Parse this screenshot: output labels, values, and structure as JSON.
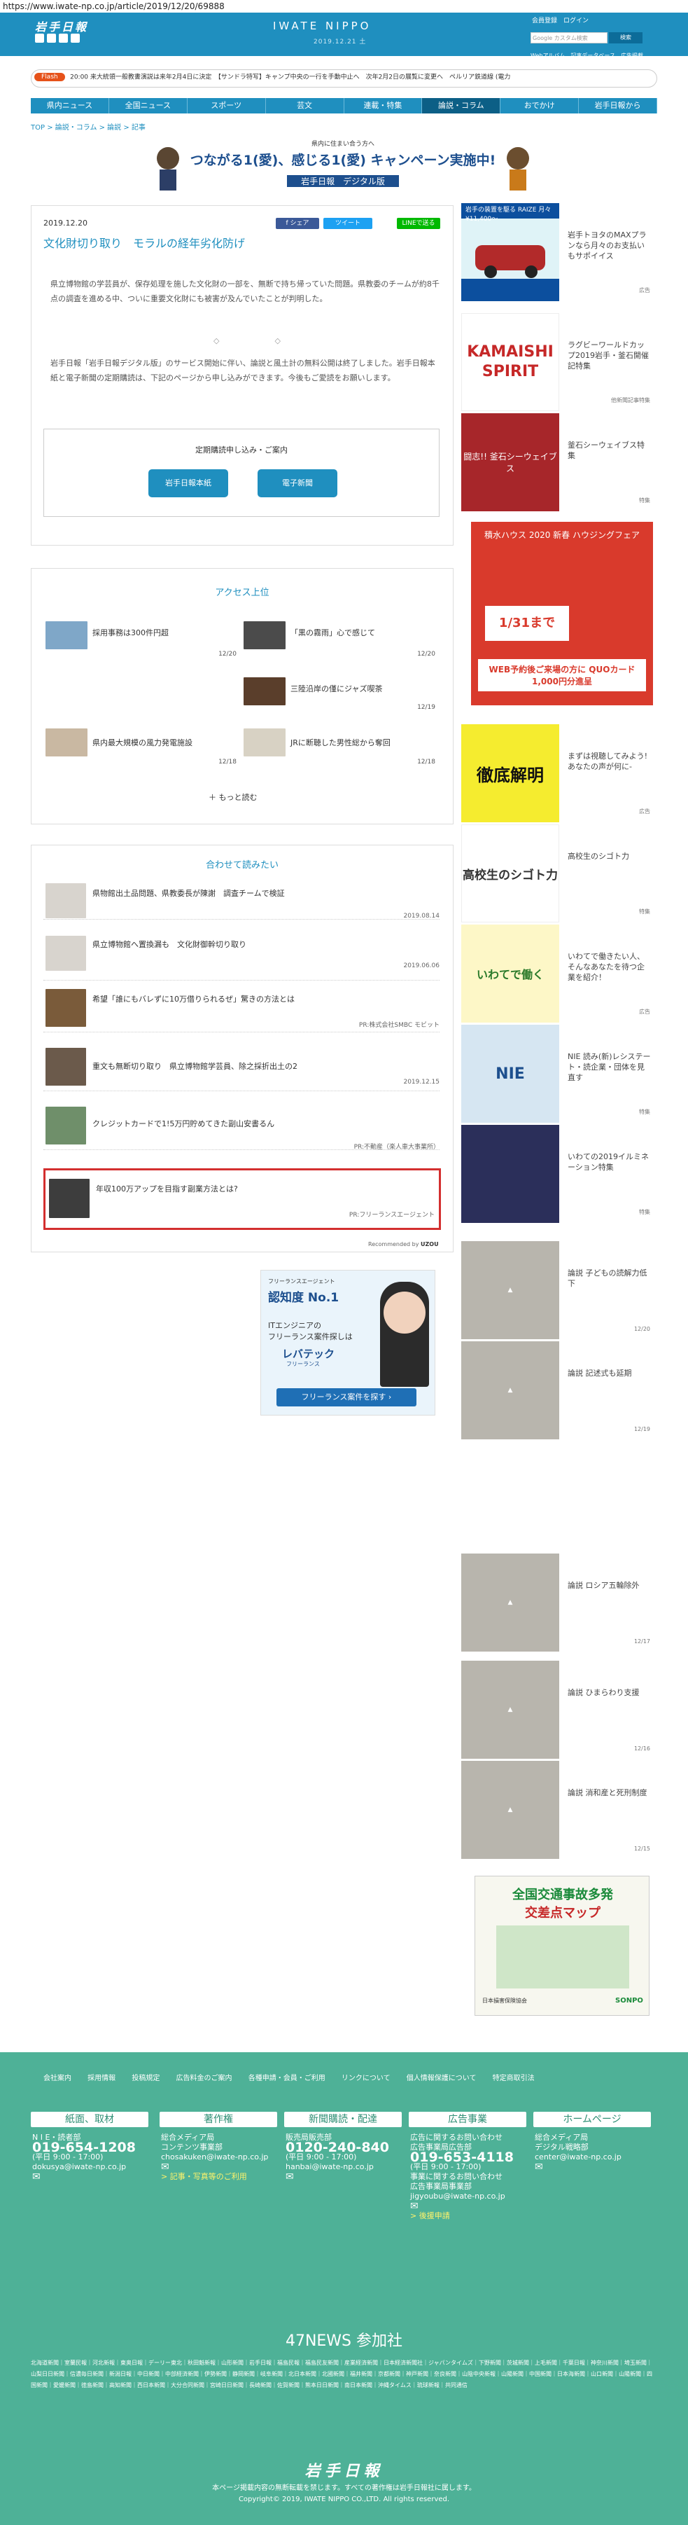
{
  "url": "https://www.iwate-np.co.jp/article/2019/12/20/69888",
  "header": {
    "logo": "岩手日報",
    "brand": "IWATE NIPPO",
    "date": "2019.12.21 土",
    "links": "会員登録　ログイン",
    "search_placeholder": "Google カスタム検索",
    "search_btn": "検索",
    "sublinks": "Webアルバム　記事データベース　広告掲載"
  },
  "flash": {
    "label": "Flash",
    "text": "20:00  来大統領一般教書演説は来年2月4日に決定　【サンドラ特写】キャンプ中央の一行を手動中止へ　次年2月2日の展覧に変更へ　ペルリア鉄道線 (電力"
  },
  "nav": [
    "県内ニュース",
    "全国ニュース",
    "スポーツ",
    "芸文",
    "連載・特集",
    "論説・コラム",
    "おでかけ",
    "岩手日報から"
  ],
  "crumb": "TOP > 論説・コラム > 論説 > 記事",
  "banner": {
    "line1": "県内に住まい合う方へ",
    "line2": "つながる1(愛)、感じる1(愛) キャンペーン実施中!",
    "line3": "岩手日報　デジタル版"
  },
  "article": {
    "date": "2019.12.20",
    "title": "文化財切り取り　モラルの経年劣化防げ",
    "share": [
      "f シェア",
      "ツイート",
      "LINEで送る"
    ],
    "p1": "県立博物館の学芸員が、保存処理を施した文化財の一部を、無断で持ち帰っていた問題。県教委のチームが約8千点の調査を進める中、ついに重要文化財にも被害が及んでいたことが判明した。",
    "diamonds": "◇　◇",
    "p2": "岩手日報「岩手日報デジタル版」のサービス開始に伴い、論説と風土計の無料公開は終了しました。岩手日報本紙と電子新聞の定期購読は、下記のページから申し込みができます。今後もご愛読をお願いします。",
    "sub_title": "定期購読申し込み・ご案内",
    "sub_btn1": "岩手日報本紙",
    "sub_btn2": "電子新聞"
  },
  "access": {
    "title": "アクセス上位",
    "items": [
      {
        "text": "採用事務は300件円超",
        "date": "12/20"
      },
      {
        "text": "「黒の霧雨」心で感じて",
        "date": "12/20"
      },
      {
        "text": "三陸沿岸の僅にジャズ喫茶",
        "date": "12/19"
      },
      {
        "text": "県内最大規模の風力発電施設",
        "date": "12/18"
      },
      {
        "text": "JRに断聴した男性総から奪回",
        "date": "12/18"
      }
    ],
    "more": "もっと読む"
  },
  "related": {
    "title": "合わせて読みたい",
    "items": [
      {
        "title": "県物館出土品問題、県教委長が陳謝　調査チームで検証",
        "meta": "2019.08.14"
      },
      {
        "title": "県立博物館へ置換漏も　文化財御幹切り取り",
        "meta": "2019.06.06"
      },
      {
        "title": "希望「誰にもバレずに10万借りられるぜ」驚きの方法とは",
        "meta": "PR:株式会社SMBC モビット"
      },
      {
        "title": "重文も無断切り取り　県立博物館学芸員、除之採折出土の2",
        "meta": "2019.12.15"
      },
      {
        "title": "クレジットカードで1!5万円貯めてきた副山安書るん",
        "meta": "PR:不動産（楽人車大事業所）"
      },
      {
        "title": "年収100万アップを目指す副業方法とは?",
        "meta": "PR:フリーランスエージェント"
      }
    ],
    "footer": "Recommended by",
    "uzou": "UZOU"
  },
  "adFree": {
    "l1": "フリーランスエージェント",
    "l2": "認知度 No.1",
    "l3": "ITエンジニアの",
    "l4": "フリーランス案件探しは",
    "l5": "レバテック",
    "l6": "フリーランス",
    "btn": "フリーランス案件を探す ›"
  },
  "side": [
    {
      "text": "岩手トヨタのMAXプランなら月々のお支払いもサポイイス",
      "meta": "広告"
    },
    {
      "text": "ラグビーワールドカップ2019岩手・釜石開催記特集",
      "meta": "他新聞記事特集"
    },
    {
      "text": "釜石シーウェイブス特集",
      "meta": "特集"
    },
    {
      "text": "",
      "meta": ""
    },
    {
      "text": "まずは視聴してみよう!あなたの声が何に-",
      "meta": "広告"
    },
    {
      "text": "高校生のシゴト力",
      "meta": "特集"
    },
    {
      "text": "いわてで働きたい人、そんなあなたを待つ企業を紹介！",
      "meta": "広告"
    },
    {
      "text": "NIE 読み(新)レシステート・読企業・団体を見直す",
      "meta": "特集"
    },
    {
      "text": "いわての2019イルミネーション特集",
      "meta": "特集"
    },
    {
      "text": "論説 子どもの読解力低下",
      "meta": "12/20"
    },
    {
      "text": "論説 記述式も延期",
      "meta": "12/19"
    },
    {
      "text": "論説 ロシア五輪除外",
      "meta": "12/17"
    },
    {
      "text": "論説 ひまらわり支援",
      "meta": "12/16"
    },
    {
      "text": "論説 消和産と死刑制度",
      "meta": "12/15"
    }
  ],
  "side_ads": {
    "toyota": "岩手の装置を駆る RAIZE 月々 ¥11,400〜",
    "kamaishi": "KAMAISHI SPIRIT",
    "seawaves": "闘志!! 釜石シーウェイブス",
    "sekisui": "積水ハウス 2020 新春 ハウジングフェア",
    "sekisui_date": "1/31まで",
    "sekisui_q": "WEB予約後ご来場の方に QUOカード1,000円分進呈",
    "tetsutei": "徹底解明",
    "shigoto": "高校生のシゴト力",
    "iwatede": "いわてで働く",
    "nie": "NIE",
    "traffic1": "全国交通事故多発",
    "traffic2": "交差点マップ",
    "traffic_by": "日本損害保険協会",
    "sonpo": "SONPO"
  },
  "footer": {
    "links": "会社案内 採用情報 投稿規定 広告料金のご案内 各種申請・会員・ご利用 リンクについて 個人情報保護について 特定商取引法",
    "cols": [
      {
        "hd": "紙面、取材",
        "c1": "N I E・読者部",
        "tel": "019-654-1208",
        "c2": "(平日 9:00 - 17:00)",
        "c3": "dokusya@iwate-np.co.jp"
      },
      {
        "hd": "著作権",
        "c1": "総合メディア局\nコンテンツ事業部",
        "c3": "chosakuken@iwate-np.co.jp",
        "c4": "> 記事・写真等のご利用"
      },
      {
        "hd": "新聞購読・配達",
        "c1": "販売局販売部",
        "tel": "0120-240-840",
        "c2": "(平日 9:00 - 17:00)",
        "c3": "hanbai@iwate-np.co.jp"
      },
      {
        "hd": "広告事業",
        "c1": "広告に関するお問い合わせ\n広告事業局広告部",
        "tel": "019-653-4118",
        "c2": "(平日 9:00 - 17:00)",
        "c3": "事業に関するお問い合わせ\n広告事業局事業部",
        "c4": "jigyoubu@iwate-np.co.jp",
        "c5": "> 後援申請"
      },
      {
        "hd": "ホームページ",
        "c1": "総合メディア局\nデジタル戦略部",
        "c3": "center@iwate-np.co.jp"
      }
    ],
    "news47": "47NEWS 参加社",
    "papers": "北海道新聞｜室蘭民報｜河北新報｜東奥日報｜デーリー東北｜秋田魁新報｜山形新聞｜岩手日報｜福島民報｜福島民友新聞｜産業経済新聞｜日本経済新聞社｜ジャパンタイムズ｜下野新聞｜茨城新聞｜上毛新聞｜千葉日報｜神奈川新聞｜埼玉新聞｜山梨日日新聞｜信濃毎日新聞｜新潟日報｜中日新聞｜中部経済新聞｜伊勢新聞｜静岡新聞｜岐阜新聞｜北日本新聞｜北國新聞｜福井新聞｜京都新聞｜神戸新聞｜奈良新聞｜山陰中央新報｜山陽新聞｜中国新聞｜日本海新聞｜山口新聞｜山陽新聞｜四国新聞｜愛媛新聞｜徳島新聞｜高知新聞｜西日本新聞｜大分合同新聞｜宮崎日日新聞｜長崎新聞｜佐賀新聞｜熊本日日新聞｜南日本新聞｜沖縄タイムス｜琉球新報｜共同通信",
    "logo": "岩手日報",
    "copy1": "本ページ掲載内容の無断転載を禁じます。すべての著作権は岩手日報社に属します。",
    "copy2": "Copyright© 2019, IWATE NIPPO CO.,LTD. All rights reserved."
  }
}
